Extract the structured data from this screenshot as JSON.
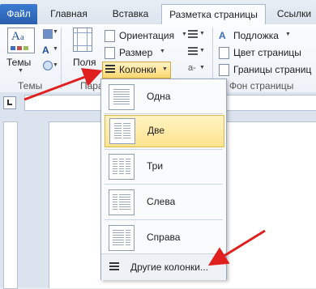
{
  "tabs": {
    "file": "Файл",
    "home": "Главная",
    "insert": "Вставка",
    "page_layout": "Разметка страницы",
    "references": "Ссылки"
  },
  "ribbon": {
    "themes": {
      "button": "Темы",
      "group_label": "Темы"
    },
    "page_setup": {
      "margins": "Поля",
      "orientation": "Ориентация",
      "size": "Размер",
      "columns": "Колонки",
      "group_label": "Пара"
    },
    "page_background": {
      "watermark": "Подложка",
      "page_color": "Цвет страницы",
      "page_borders": "Границы страниц",
      "group_label": "Фон страницы"
    }
  },
  "columns_menu": {
    "items": [
      {
        "label": "Одна",
        "icon": "one-column-icon"
      },
      {
        "label": "Две",
        "icon": "two-columns-icon"
      },
      {
        "label": "Три",
        "icon": "three-columns-icon"
      },
      {
        "label": "Слева",
        "icon": "left-column-icon"
      },
      {
        "label": "Справа",
        "icon": "right-column-icon"
      }
    ],
    "highlighted_index": 1,
    "more": "Другие колонки..."
  },
  "colors": {
    "file_tab": "#2a5fae",
    "highlight": "#fde48f",
    "arrow": "#e0201f"
  }
}
